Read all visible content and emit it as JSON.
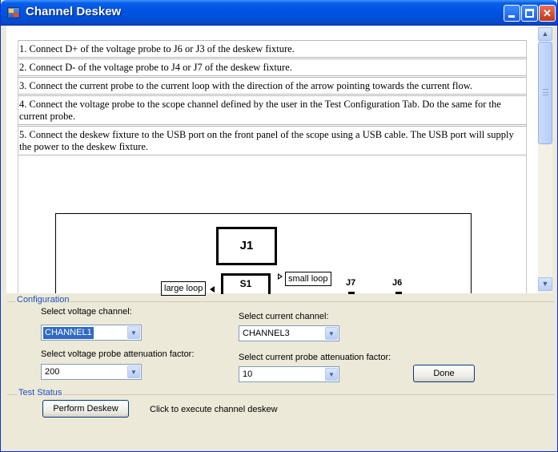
{
  "window": {
    "title": "Channel Deskew"
  },
  "instructions": [
    "1. Connect D+ of the voltage probe to J6 or J3 of the deskew fixture.",
    "2. Connect D- of the voltage probe to J4 or J7 of the deskew fixture.",
    "3. Connect the current probe to the current loop with the direction of the arrow pointing towards the current flow.",
    "4. Connect the voltage probe to the scope channel defined by the user in the Test Configuration Tab. Do the same for the current probe.",
    "5. Connect the deskew fixture to the USB port on the front panel of the scope using a USB cable. The USB port will supply the power to the deskew fixture."
  ],
  "diagram": {
    "j1": "J1",
    "s1": "S1",
    "small_loop": "small loop",
    "large_loop": "large loop",
    "j7": "J7",
    "j6": "J6"
  },
  "configuration": {
    "group_label": "Configuration",
    "voltage_channel_label": "Select voltage channel:",
    "voltage_channel_value": "CHANNEL1",
    "current_channel_label": "Select current channel:",
    "current_channel_value": "CHANNEL3",
    "voltage_atten_label": "Select voltage probe attenuation factor:",
    "voltage_atten_value": "200",
    "current_atten_label": "Select current probe attenuation factor:",
    "current_atten_value": "10",
    "done_label": "Done"
  },
  "test_status": {
    "group_label": "Test Status",
    "perform_label": "Perform Deskew",
    "hint": "Click to execute channel deskew"
  },
  "colors": {
    "titlebar": "#0054e3",
    "group_label": "#1c4fbf",
    "selection": "#316ac5"
  }
}
